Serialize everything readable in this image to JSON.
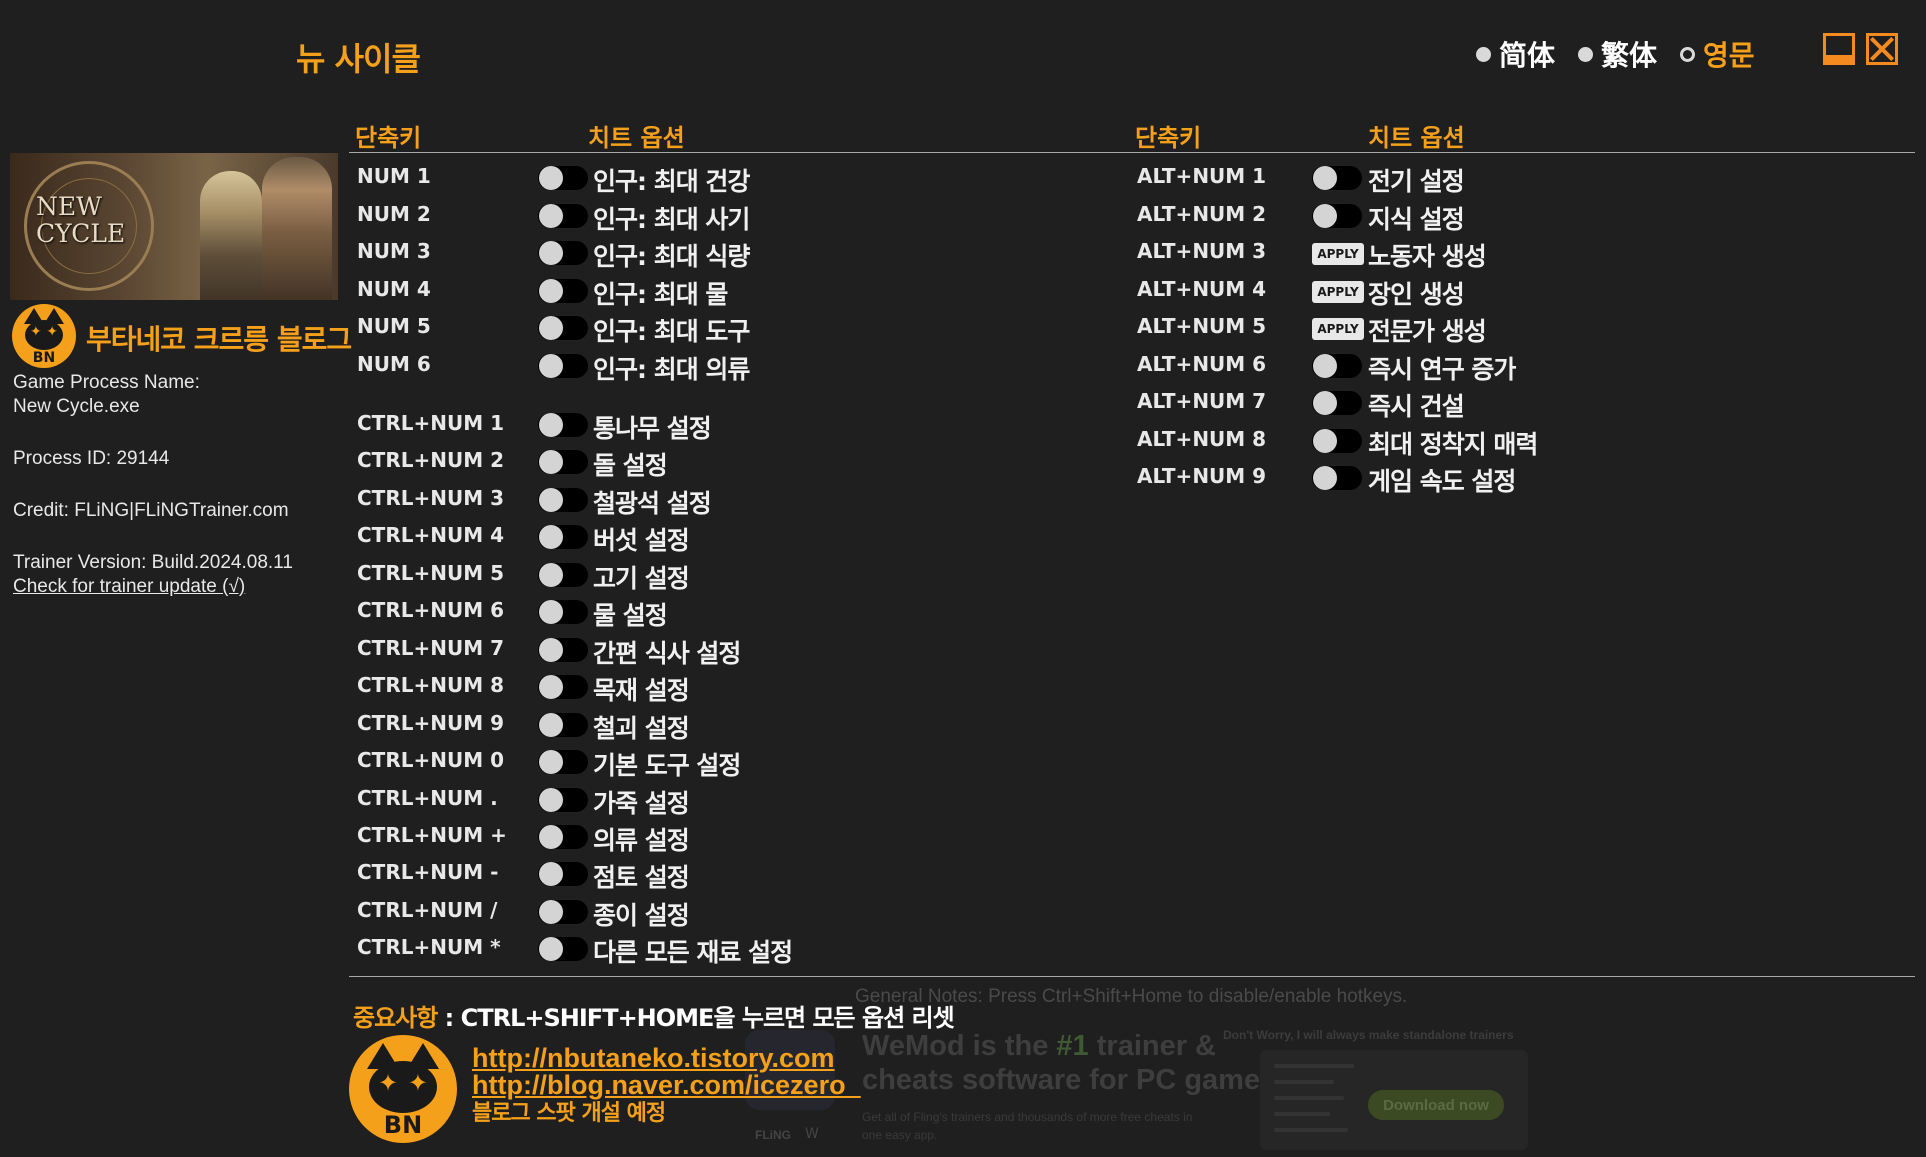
{
  "window": {
    "title": "뉴 사이클",
    "languages": [
      {
        "label": "简体",
        "active": false
      },
      {
        "label": "繁体",
        "active": false
      },
      {
        "label": "영문",
        "active": true
      }
    ]
  },
  "sidebar": {
    "game_logo": "NEW CYCLE",
    "blog_title": "부타네코 크르릉 블로그",
    "process_name_label": "Game Process Name:",
    "process_name": "New Cycle.exe",
    "process_id": "Process ID: 29144",
    "credit": "Credit: FLiNG|FLiNGTrainer.com",
    "version": "Trainer Version: Build.2024.08.11",
    "update_link": "Check for trainer update (√)"
  },
  "headers": {
    "hotkey": "단축키",
    "option": "치트 옵션"
  },
  "left_options": [
    {
      "key": "NUM 1",
      "label": "인구: 최대 건강",
      "type": "toggle"
    },
    {
      "key": "NUM 2",
      "label": "인구: 최대 사기",
      "type": "toggle"
    },
    {
      "key": "NUM 3",
      "label": "인구: 최대 식량",
      "type": "toggle"
    },
    {
      "key": "NUM 4",
      "label": "인구: 최대 물",
      "type": "toggle"
    },
    {
      "key": "NUM 5",
      "label": "인구: 최대 도구",
      "type": "toggle"
    },
    {
      "key": "NUM 6",
      "label": "인구: 최대 의류",
      "type": "toggle"
    },
    {
      "key": "CTRL+NUM 1",
      "label": "통나무 설정",
      "type": "toggle"
    },
    {
      "key": "CTRL+NUM 2",
      "label": "돌 설정",
      "type": "toggle"
    },
    {
      "key": "CTRL+NUM 3",
      "label": "철광석 설정",
      "type": "toggle"
    },
    {
      "key": "CTRL+NUM 4",
      "label": "버섯 설정",
      "type": "toggle"
    },
    {
      "key": "CTRL+NUM 5",
      "label": "고기 설정",
      "type": "toggle"
    },
    {
      "key": "CTRL+NUM 6",
      "label": "물 설정",
      "type": "toggle"
    },
    {
      "key": "CTRL+NUM 7",
      "label": "간편 식사 설정",
      "type": "toggle"
    },
    {
      "key": "CTRL+NUM 8",
      "label": "목재 설정",
      "type": "toggle"
    },
    {
      "key": "CTRL+NUM 9",
      "label": "철괴 설정",
      "type": "toggle"
    },
    {
      "key": "CTRL+NUM 0",
      "label": "기본 도구 설정",
      "type": "toggle"
    },
    {
      "key": "CTRL+NUM .",
      "label": "가죽 설정",
      "type": "toggle"
    },
    {
      "key": "CTRL+NUM +",
      "label": "의류 설정",
      "type": "toggle"
    },
    {
      "key": "CTRL+NUM -",
      "label": "점토 설정",
      "type": "toggle"
    },
    {
      "key": "CTRL+NUM /",
      "label": "종이 설정",
      "type": "toggle"
    },
    {
      "key": "CTRL+NUM *",
      "label": "다른 모든 재료 설정",
      "type": "toggle"
    }
  ],
  "right_options": [
    {
      "key": "ALT+NUM 1",
      "label": "전기 설정",
      "type": "toggle"
    },
    {
      "key": "ALT+NUM 2",
      "label": "지식 설정",
      "type": "toggle"
    },
    {
      "key": "ALT+NUM 3",
      "label": "노동자 생성",
      "type": "apply"
    },
    {
      "key": "ALT+NUM 4",
      "label": "장인 생성",
      "type": "apply"
    },
    {
      "key": "ALT+NUM 5",
      "label": "전문가 생성",
      "type": "apply"
    },
    {
      "key": "ALT+NUM 6",
      "label": "즉시 연구 증가",
      "type": "toggle"
    },
    {
      "key": "ALT+NUM 7",
      "label": "즉시 건설",
      "type": "toggle"
    },
    {
      "key": "ALT+NUM 8",
      "label": "최대 정착지 매력",
      "type": "toggle"
    },
    {
      "key": "ALT+NUM 9",
      "label": "게임 속도 설정",
      "type": "toggle"
    }
  ],
  "apply_label": "APPLY",
  "ad": {
    "general_notes": "General Notes: Press Ctrl+Shift+Home to disable/enable hotkeys.",
    "headline_pre": "WeMod is the ",
    "headline_highlight": "#1",
    "headline_post": " trainer & cheats software for PC games",
    "subtext": "Get all of Fling's trainers and thousands of more free cheats in one easy app.",
    "dont_worry": "Don't Worry, I will always make standalone trainers",
    "download": "Download now",
    "brand": "FLiNG",
    "brand2": "W"
  },
  "footer": {
    "notice_label": "중요사항",
    "notice_text": " : CTRL+SHIFT+HOME을 누르면 모든 옵션 리셋",
    "link1": "http://nbutaneko.tistory.com",
    "link2": "http://blog.naver.com/icezero_",
    "note": "블로그 스팟 개설 예정"
  },
  "colors": {
    "accent": "#f5a01a",
    "background": "#1f1f1f",
    "text": "#e8e8e8"
  }
}
